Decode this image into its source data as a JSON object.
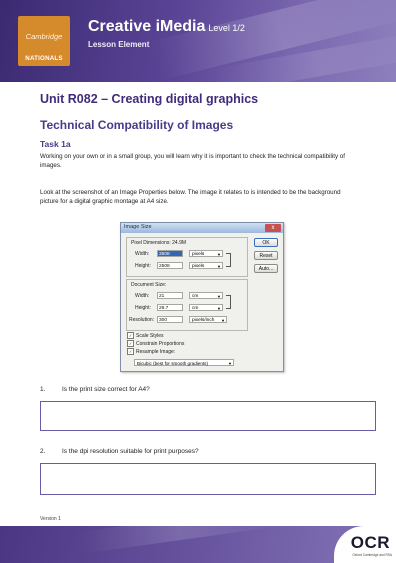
{
  "header": {
    "logo_top": "Cambridge",
    "logo_bottom": "NATIONALS",
    "course_title": "Creative iMedia",
    "course_level": "Level 1/2",
    "subtitle": "Lesson Element"
  },
  "unit_title": "Unit R082 – Creating digital graphics",
  "section_title": "Technical Compatibility of Images",
  "task_heading": "Task 1a",
  "paragraphs": [
    "Working on your own or in a small group, you will learn why it is important to check the technical compatibility of images.",
    "Look at the screenshot of an Image Properties below. The image it relates to is intended to be the background picture for a digital graphic montage at A4 size."
  ],
  "dialog": {
    "title": "Image Size",
    "close_label": "x",
    "pixel_dims_label": "Pixel Dimensions:",
    "pixel_dims_value": "24.9M",
    "width_label": "Width:",
    "width_value": "3508",
    "height_label": "Height:",
    "height_value": "2508",
    "pixel_unit": "pixels",
    "doc_size_label": "Document Size:",
    "doc_width_label": "Width:",
    "doc_width_value": "21",
    "doc_height_label": "Height:",
    "doc_height_value": "29.7",
    "doc_unit": "cm",
    "resolution_label": "Resolution:",
    "resolution_value": "300",
    "resolution_unit": "pixels/inch",
    "ok_label": "OK",
    "reset_label": "Reset",
    "auto_label": "Auto...",
    "scale_styles_label": "Scale Styles",
    "constrain_label": "Constrain Proportions",
    "resample_label": "Resample Image:",
    "resample_value": "Bicubic (best for smooth gradients)"
  },
  "questions": [
    {
      "number": "1.",
      "text": "Is the print size correct for A4?"
    },
    {
      "number": "2.",
      "text": "Is the dpi resolution suitable for print purposes?"
    }
  ],
  "version": "Version 1",
  "footer": {
    "logo": "OCR",
    "tagline": "Oxford Cambridge and RSA"
  },
  "colors": {
    "brand_purple": "#4a3a8a",
    "logo_orange": "#d58a2c"
  }
}
